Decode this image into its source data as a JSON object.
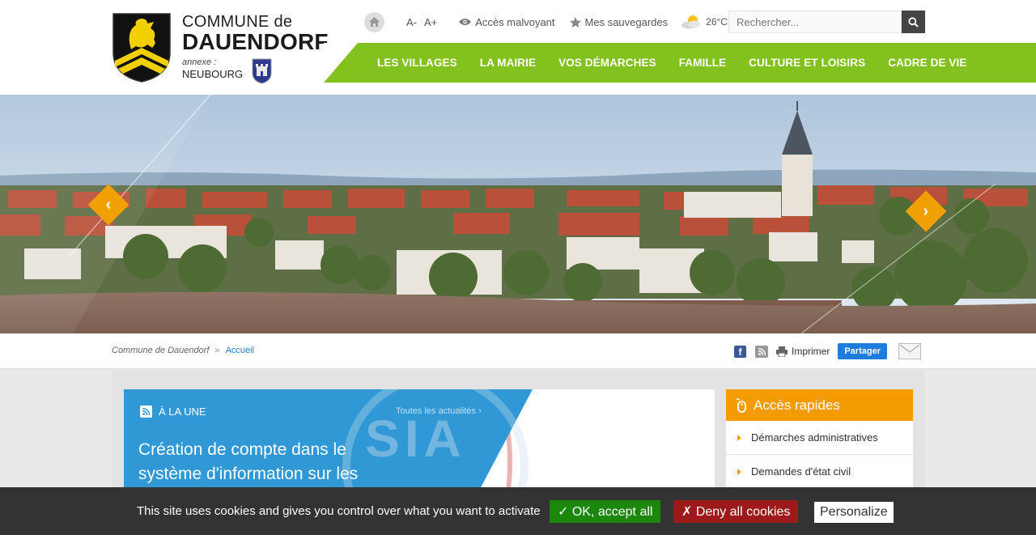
{
  "header": {
    "commune_prefix": "COMMUNE de",
    "commune_name": "DAUENDORF",
    "annexe_label": "annexe :",
    "annexe_name": "NEUBOURG"
  },
  "topbar": {
    "font_decrease": "A-",
    "font_increase": "A+",
    "accessibility": "Accès malvoyant",
    "saved": "Mes sauvegardes",
    "temperature": "26°C",
    "search_placeholder": "Rechercher..."
  },
  "nav": {
    "items": [
      "LES VILLAGES",
      "LA MAIRIE",
      "VOS DÉMARCHES",
      "FAMILLE",
      "CULTURE ET LOISIRS",
      "CADRE DE VIE"
    ]
  },
  "breadcrumb": {
    "root": "Commune de Dauendorf",
    "separator": "»",
    "current": "Accueil"
  },
  "tools": {
    "print": "Imprimer",
    "share": "Partager"
  },
  "news": {
    "section": "À LA UNE",
    "all_link": "Toutes les actualités",
    "title": "Création de compte dans le système d'information sur les",
    "stamp_text": "SIA"
  },
  "quick_access": {
    "title": "Accès rapides",
    "items": [
      "Démarches administratives",
      "Demandes d'état civil"
    ]
  },
  "cookie": {
    "text": "This site uses cookies and gives you control over what you want to activate",
    "accept": "✓ OK, accept all",
    "deny": "✗ Deny all cookies",
    "personalize": "Personalize"
  },
  "colors": {
    "nav_green": "#83c11f",
    "accent_orange": "#f49b00",
    "news_blue": "#2f98d5",
    "accept_green": "#1b870b",
    "deny_red": "#9c1a1a"
  }
}
